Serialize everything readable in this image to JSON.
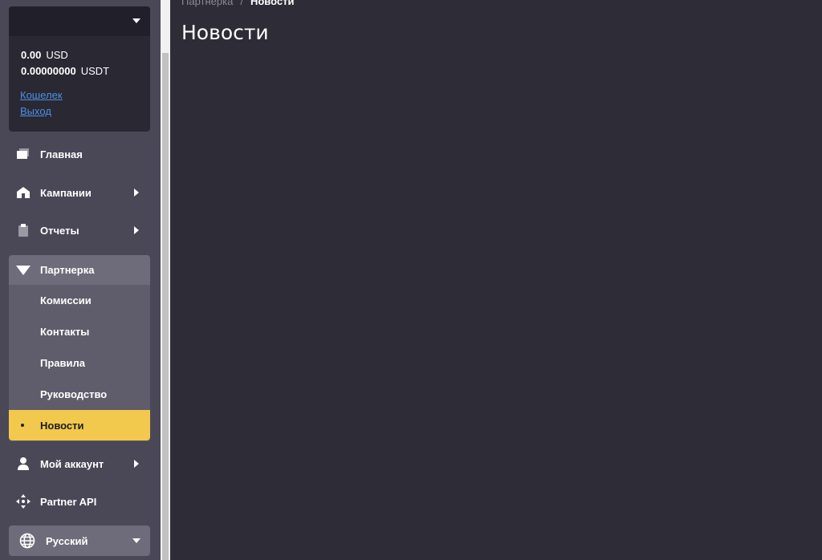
{
  "account": {
    "balances": [
      {
        "amount": "0.00",
        "currency": "USD"
      },
      {
        "amount": "0.00000000",
        "currency": "USDT"
      }
    ],
    "links": [
      "Кошелек",
      "Выход"
    ]
  },
  "nav": {
    "home": "Главная",
    "campaigns": "Кампании",
    "reports": "Отчеты",
    "partner": "Партнерка",
    "partner_sub": [
      "Комиссии",
      "Контакты",
      "Правила",
      "Руководство",
      "Новости"
    ],
    "account": "Мой аккаунт",
    "api": "Partner API"
  },
  "language": {
    "selected": "Русский"
  },
  "breadcrumb": {
    "parent": "Партнерка",
    "separator": "/",
    "current": "Новости"
  },
  "page": {
    "title": "Новости"
  },
  "colors": {
    "accent": "#f2c94c",
    "link": "#4f8fe6",
    "background": "#2e2c37",
    "sidebar": "#4a4857"
  }
}
